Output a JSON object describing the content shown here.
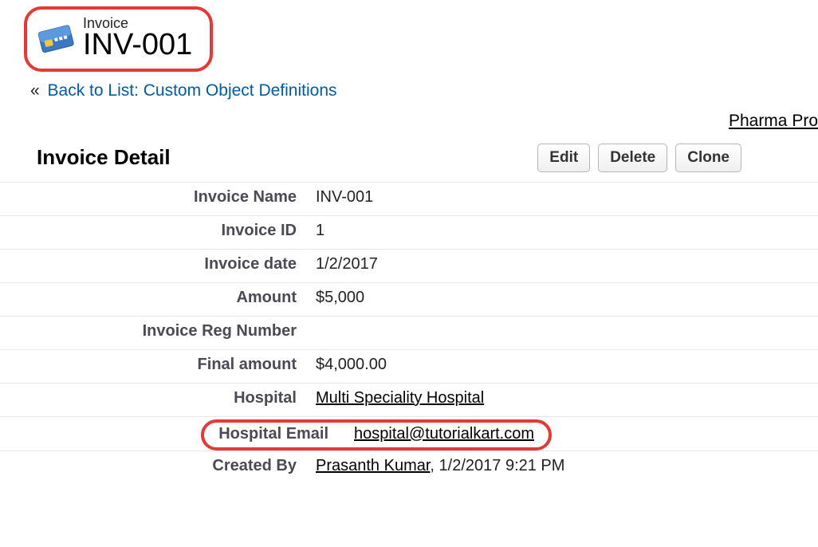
{
  "header": {
    "object_type": "Invoice",
    "record_name": "INV-001"
  },
  "nav": {
    "back_prefix": "«",
    "back_label": "Back to List: Custom Object Definitions",
    "right_link": "Pharma Pro"
  },
  "section": {
    "title": "Invoice Detail"
  },
  "actions": {
    "edit": "Edit",
    "delete": "Delete",
    "clone": "Clone"
  },
  "fields": {
    "invoice_name": {
      "label": "Invoice Name",
      "value": "INV-001"
    },
    "invoice_id": {
      "label": "Invoice ID",
      "value": "1"
    },
    "invoice_date": {
      "label": "Invoice date",
      "value": "1/2/2017"
    },
    "amount": {
      "label": "Amount",
      "value": "$5,000"
    },
    "reg_number": {
      "label": "Invoice Reg Number",
      "value": ""
    },
    "final_amount": {
      "label": "Final amount",
      "value": "$4,000.00"
    },
    "hospital": {
      "label": "Hospital",
      "value": "Multi Speciality Hospital"
    },
    "hospital_email": {
      "label": "Hospital Email",
      "value": "hospital@tutorialkart.com"
    },
    "created_by": {
      "label": "Created By",
      "user": "Prasanth Kumar",
      "suffix": ", 1/2/2017 9:21 PM"
    }
  }
}
